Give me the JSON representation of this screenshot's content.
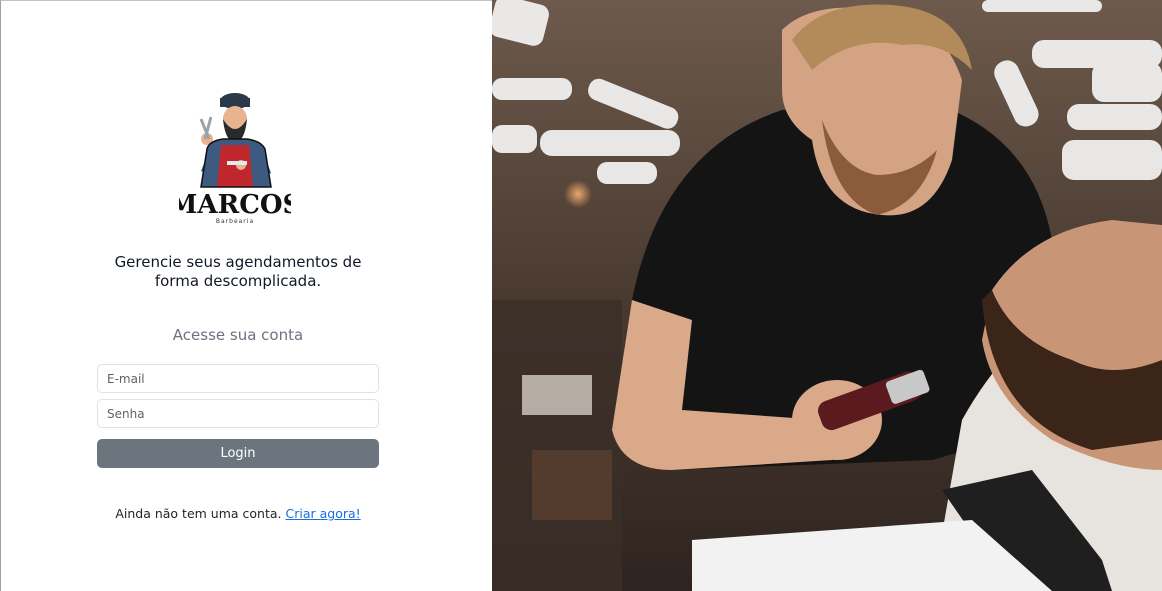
{
  "brand": {
    "name": "MARCOS",
    "subname": "Barbearia"
  },
  "tagline": {
    "line1": "Gerencie seus agendamentos de",
    "line2": "forma descomplicada."
  },
  "form": {
    "title": "Acesse sua conta",
    "email_placeholder": "E-mail",
    "password_placeholder": "Senha",
    "login_label": "Login"
  },
  "signup": {
    "prompt": "Ainda não tem uma conta.",
    "link_label": "Criar agora!"
  },
  "colors": {
    "button": "#6c757d",
    "link": "#1a6ee0",
    "title_text": "#6b7280"
  },
  "hero_image": {
    "subject": "barber-trimming-beard-photo"
  }
}
